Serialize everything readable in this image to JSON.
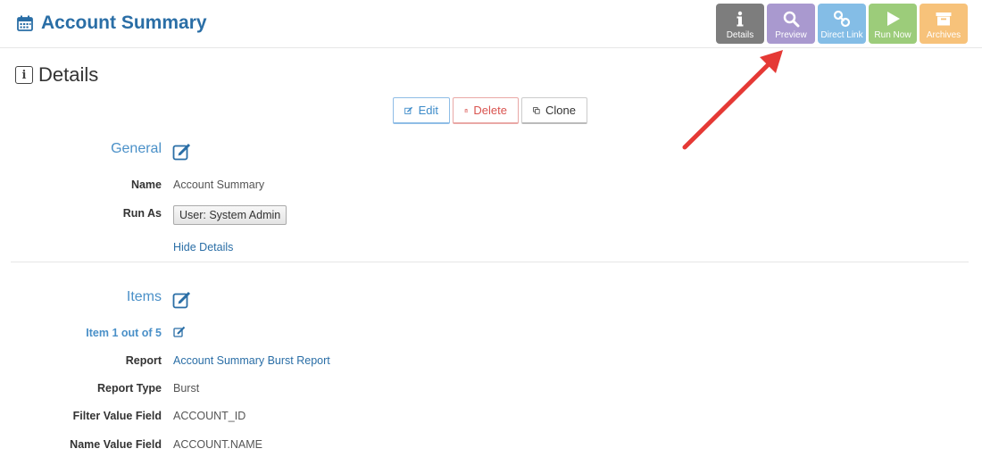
{
  "header": {
    "title": "Account Summary",
    "title_icon": "calendar-icon"
  },
  "toolbar": {
    "details": "Details",
    "preview": "Preview",
    "direct_link": "Direct Link",
    "run_now": "Run Now",
    "archives": "Archives"
  },
  "details": {
    "heading": "Details",
    "heading_icon": "info-icon"
  },
  "actions": {
    "edit": "Edit",
    "delete": "Delete",
    "clone": "Clone"
  },
  "general": {
    "title": "General",
    "name_label": "Name",
    "name_value": "Account Summary",
    "run_as_label": "Run As",
    "run_as_value": "User: System Admin",
    "hide_details": "Hide Details"
  },
  "items": {
    "title": "Items",
    "item_label": "Item 1 out of 5",
    "report_label": "Report",
    "report_value": "Account Summary Burst Report",
    "report_type_label": "Report Type",
    "report_type_value": "Burst",
    "filter_label": "Filter Value Field",
    "filter_value": "ACCOUNT_ID",
    "name_field_label": "Name Value Field",
    "name_field_value": "ACCOUNT.NAME"
  },
  "colors": {
    "accent": "#2a6ea6",
    "section": "#4a90c8",
    "details_btn": "#7d7d7d",
    "preview_btn": "#a999cf",
    "direct_btn": "#84bde6",
    "run_btn": "#9ccc7a",
    "archives_btn": "#f7c27a",
    "arrow": "#e53935"
  }
}
